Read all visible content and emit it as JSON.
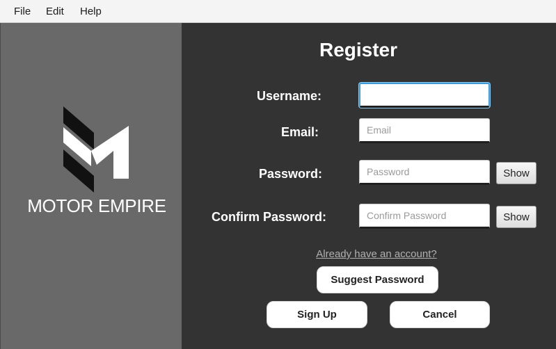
{
  "menu": {
    "file": "File",
    "edit": "Edit",
    "help": "Help"
  },
  "brand": {
    "name": "MOTOR EMPIRE"
  },
  "form": {
    "title": "Register",
    "username_label": "Username:",
    "username_value": "",
    "username_placeholder": "",
    "email_label": "Email:",
    "email_placeholder": "Email",
    "password_label": "Password:",
    "password_placeholder": "Password",
    "password_show": "Show",
    "confirm_label": "Confirm Password:",
    "confirm_placeholder": "Confirm Password",
    "confirm_show": "Show",
    "login_link": "Already have an account?",
    "suggest_button": "Suggest Password",
    "signup_button": "Sign Up",
    "cancel_button": "Cancel"
  },
  "colors": {
    "menubar_bg": "#f4f4f4",
    "left_panel_bg": "#696969",
    "right_panel_bg": "#333333",
    "focus_ring": "#3d9ad4"
  }
}
